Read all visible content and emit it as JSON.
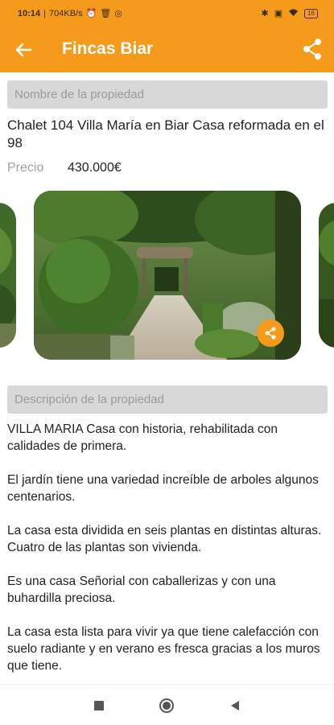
{
  "status_bar": {
    "time": "10:14",
    "network_speed": "704KB/s",
    "battery": "16",
    "icons": [
      "alarm-icon",
      "trash-icon",
      "whatsapp-icon",
      "bluetooth-icon",
      "screen-icon",
      "wifi-icon",
      "battery-icon"
    ]
  },
  "app_bar": {
    "title": "Fincas Biar",
    "back_icon": "arrow-left-icon",
    "share_icon": "share-icon"
  },
  "property": {
    "name_label": "Nombre de la propiedad",
    "name": "Chalet 104 Villa María en Biar Casa reformada en el 98",
    "price_label": "Precio",
    "price": "430.000€"
  },
  "description": {
    "label": "Descripción de la propiedad",
    "paragraphs": [
      "VILLA MARIA  Casa con historia, rehabilitada con calidades de primera.",
      "El jardín tiene una variedad increíble de arboles algunos centenarios.",
      "La casa esta dividida en seis plantas en distintas alturas. Cuatro de las plantas son vivienda.",
      "Es una casa Señorial con caballerizas y con una buhardilla preciosa.",
      "La casa esta lista para vivir ya que tiene calefacción con suelo radiante y en verano es fresca gracias a los muros que tiene."
    ]
  },
  "colors": {
    "accent": "#f59a1a",
    "label_bg": "#d8d8d8"
  },
  "nav_bar": {
    "icons": [
      "square-recent-icon",
      "circle-home-icon",
      "triangle-back-icon"
    ]
  }
}
